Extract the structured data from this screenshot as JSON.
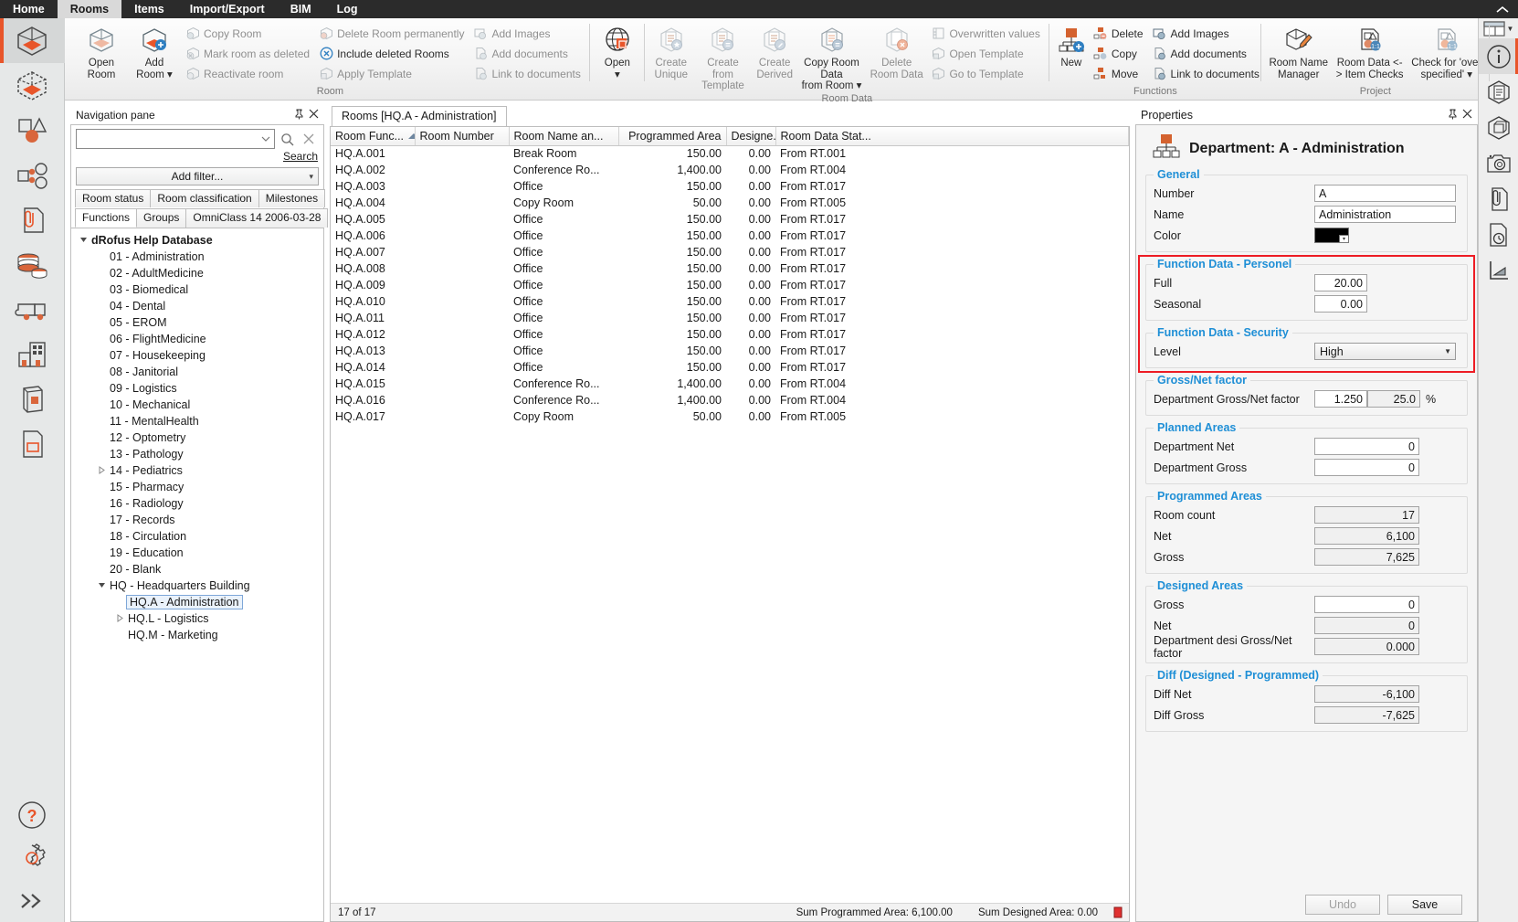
{
  "menubar": {
    "items": [
      {
        "label": "Home",
        "active": false
      },
      {
        "label": "Rooms",
        "active": true
      },
      {
        "label": "Items",
        "active": false
      },
      {
        "label": "Import/Export",
        "active": false
      },
      {
        "label": "BIM",
        "active": false
      },
      {
        "label": "Log",
        "active": false
      }
    ]
  },
  "ribbon": {
    "groups": [
      {
        "title": "Room",
        "big": [
          {
            "label": "Open\nRoom",
            "icon": "open-room-icon",
            "dim": false
          },
          {
            "label": "Add\nRoom ▾",
            "icon": "add-room-icon",
            "dim": false
          }
        ],
        "smallcols": [
          [
            {
              "label": "Copy Room",
              "icon": "copy-room-icon",
              "dim": true
            },
            {
              "label": "Mark room as deleted",
              "icon": "mark-deleted-icon",
              "dim": true
            },
            {
              "label": "Reactivate room",
              "icon": "reactivate-room-icon",
              "dim": true
            }
          ],
          [
            {
              "label": "Delete Room permanently",
              "icon": "delete-room-icon",
              "dim": true
            },
            {
              "label": "Include deleted Rooms",
              "icon": "include-deleted-icon",
              "dim": false
            },
            {
              "label": "Apply Template",
              "icon": "apply-template-icon",
              "dim": true
            }
          ],
          [
            {
              "label": "Add Images",
              "icon": "add-images-icon",
              "dim": true
            },
            {
              "label": "Add documents",
              "icon": "add-documents-icon",
              "dim": true
            },
            {
              "label": "Link to documents",
              "icon": "link-documents-icon",
              "dim": true
            }
          ]
        ]
      },
      {
        "title": "",
        "big": [
          {
            "label": "Open\n▾",
            "icon": "open-globe-icon",
            "dim": false
          }
        ],
        "smallcols": []
      },
      {
        "title": "Room Data",
        "big": [
          {
            "label": "Create\nUnique",
            "icon": "create-unique-icon",
            "dim": true
          },
          {
            "label": "Create from\nTemplate",
            "icon": "create-from-template-icon",
            "dim": true
          },
          {
            "label": "Create\nDerived",
            "icon": "create-derived-icon",
            "dim": true
          },
          {
            "label": "Copy Room Data\nfrom Room ▾",
            "icon": "copy-room-data-icon",
            "dim": false
          },
          {
            "label": "Delete\nRoom Data",
            "icon": "delete-room-data-icon",
            "dim": true
          }
        ],
        "smallcols": [
          [
            {
              "label": "Overwritten values",
              "icon": "overwritten-values-icon",
              "dim": true
            },
            {
              "label": "Open Template",
              "icon": "open-template-icon",
              "dim": true
            },
            {
              "label": "Go to Template",
              "icon": "go-to-template-icon",
              "dim": true
            }
          ]
        ]
      },
      {
        "title": "Functions",
        "big": [
          {
            "label": "New",
            "icon": "new-function-icon",
            "dim": false
          }
        ],
        "smallcols": [
          [
            {
              "label": "Delete",
              "icon": "delete-function-icon",
              "dim": false
            },
            {
              "label": "Copy",
              "icon": "copy-function-icon",
              "dim": false
            },
            {
              "label": "Move",
              "icon": "move-function-icon",
              "dim": false
            }
          ],
          [
            {
              "label": "Add Images",
              "icon": "add-images-icon",
              "dim": false
            },
            {
              "label": "Add documents",
              "icon": "add-documents-icon",
              "dim": false
            },
            {
              "label": "Link to documents",
              "icon": "link-documents-icon",
              "dim": false
            }
          ]
        ]
      },
      {
        "title": "Project",
        "big": [
          {
            "label": "Room Name\nManager",
            "icon": "room-name-manager-icon",
            "dim": false
          },
          {
            "label": "Room Data <-\n> Item Checks",
            "icon": "room-data-item-checks-icon",
            "dim": false
          },
          {
            "label": "Check for 'over\nspecified' ▾",
            "icon": "check-over-specified-icon",
            "dim": false
          }
        ],
        "smallcols": []
      }
    ]
  },
  "leftrail": {
    "items": [
      {
        "icon": "rooms-cube-icon",
        "name": "rail-rooms",
        "selected": true
      },
      {
        "icon": "rooms-dashed-cube-icon",
        "name": "rail-room-templates",
        "selected": false
      },
      {
        "icon": "items-shapes-icon",
        "name": "rail-items",
        "selected": false
      },
      {
        "icon": "item-groups-icon",
        "name": "rail-item-groups",
        "selected": false
      },
      {
        "icon": "documents-clip-icon",
        "name": "rail-documents",
        "selected": false
      },
      {
        "icon": "coins-icon",
        "name": "rail-cost",
        "selected": false
      },
      {
        "icon": "truck-icon",
        "name": "rail-logistics",
        "selected": false
      },
      {
        "icon": "building-icon",
        "name": "rail-building",
        "selected": false
      },
      {
        "icon": "catalogue-book-icon",
        "name": "rail-catalogue",
        "selected": false
      },
      {
        "icon": "report-page-icon",
        "name": "rail-reports",
        "selected": false
      }
    ],
    "bottom": [
      {
        "icon": "help-question-icon",
        "name": "rail-help"
      },
      {
        "icon": "settings-gear-icon",
        "name": "rail-settings"
      },
      {
        "icon": "expand-chevrons-icon",
        "name": "rail-expand"
      }
    ]
  },
  "navpane": {
    "title": "Navigation pane",
    "search": {
      "value": "",
      "placeholder": "",
      "link_label": "Search"
    },
    "filter_button": "Add filter...",
    "tabs_row1": [
      {
        "label": "Room status",
        "active": false
      },
      {
        "label": "Room classification",
        "active": false
      },
      {
        "label": "Milestones",
        "active": false
      }
    ],
    "tabs_row2": [
      {
        "label": "Functions",
        "active": true
      },
      {
        "label": "Groups",
        "active": false
      },
      {
        "label": "OmniClass 14 2006-03-28",
        "active": false
      }
    ],
    "tree": [
      {
        "label": "dRofus Help Database",
        "indent": 0,
        "expander": "expanded",
        "bold": true,
        "selected": false
      },
      {
        "label": "01 - Administration",
        "indent": 1,
        "expander": "none",
        "bold": false,
        "selected": false
      },
      {
        "label": "02 - AdultMedicine",
        "indent": 1,
        "expander": "none",
        "bold": false,
        "selected": false
      },
      {
        "label": "03 - Biomedical",
        "indent": 1,
        "expander": "none",
        "bold": false,
        "selected": false
      },
      {
        "label": "04 - Dental",
        "indent": 1,
        "expander": "none",
        "bold": false,
        "selected": false
      },
      {
        "label": "05 - EROM",
        "indent": 1,
        "expander": "none",
        "bold": false,
        "selected": false
      },
      {
        "label": "06 - FlightMedicine",
        "indent": 1,
        "expander": "none",
        "bold": false,
        "selected": false
      },
      {
        "label": "07 - Housekeeping",
        "indent": 1,
        "expander": "none",
        "bold": false,
        "selected": false
      },
      {
        "label": "08 - Janitorial",
        "indent": 1,
        "expander": "none",
        "bold": false,
        "selected": false
      },
      {
        "label": "09 - Logistics",
        "indent": 1,
        "expander": "none",
        "bold": false,
        "selected": false
      },
      {
        "label": "10 - Mechanical",
        "indent": 1,
        "expander": "none",
        "bold": false,
        "selected": false
      },
      {
        "label": "11 - MentalHealth",
        "indent": 1,
        "expander": "none",
        "bold": false,
        "selected": false
      },
      {
        "label": "12 - Optometry",
        "indent": 1,
        "expander": "none",
        "bold": false,
        "selected": false
      },
      {
        "label": "13 - Pathology",
        "indent": 1,
        "expander": "none",
        "bold": false,
        "selected": false
      },
      {
        "label": "14 - Pediatrics",
        "indent": 1,
        "expander": "collapsed",
        "bold": false,
        "selected": false
      },
      {
        "label": "15 - Pharmacy",
        "indent": 1,
        "expander": "none",
        "bold": false,
        "selected": false
      },
      {
        "label": "16 - Radiology",
        "indent": 1,
        "expander": "none",
        "bold": false,
        "selected": false
      },
      {
        "label": "17 - Records",
        "indent": 1,
        "expander": "none",
        "bold": false,
        "selected": false
      },
      {
        "label": "18 - Circulation",
        "indent": 1,
        "expander": "none",
        "bold": false,
        "selected": false
      },
      {
        "label": "19 - Education",
        "indent": 1,
        "expander": "none",
        "bold": false,
        "selected": false
      },
      {
        "label": "20 - Blank",
        "indent": 1,
        "expander": "none",
        "bold": false,
        "selected": false
      },
      {
        "label": "HQ - Headquarters Building",
        "indent": 1,
        "expander": "expanded",
        "bold": false,
        "selected": false
      },
      {
        "label": "HQ.A - Administration",
        "indent": 2,
        "expander": "none",
        "bold": false,
        "selected": true
      },
      {
        "label": "HQ.L - Logistics",
        "indent": 2,
        "expander": "collapsed",
        "bold": false,
        "selected": false
      },
      {
        "label": "HQ.M - Marketing",
        "indent": 2,
        "expander": "none",
        "bold": false,
        "selected": false
      }
    ]
  },
  "grid": {
    "tab_label": "Rooms [HQ.A - Administration]",
    "columns": [
      {
        "label": "Room Func...",
        "align": "left",
        "sorted": "asc"
      },
      {
        "label": "Room Number",
        "align": "left",
        "sorted": ""
      },
      {
        "label": "Room Name an...",
        "align": "left",
        "sorted": ""
      },
      {
        "label": "Programmed Area",
        "align": "right",
        "sorted": ""
      },
      {
        "label": "Designe...",
        "align": "right",
        "sorted": ""
      },
      {
        "label": "Room Data Stat...",
        "align": "left",
        "sorted": ""
      }
    ],
    "rows": [
      [
        "HQ.A.001",
        "",
        "Break Room",
        "150.00",
        "0.00",
        "From RT.001"
      ],
      [
        "HQ.A.002",
        "",
        "Conference Ro...",
        "1,400.00",
        "0.00",
        "From RT.004"
      ],
      [
        "HQ.A.003",
        "",
        "Office",
        "150.00",
        "0.00",
        "From RT.017"
      ],
      [
        "HQ.A.004",
        "",
        "Copy Room",
        "50.00",
        "0.00",
        "From RT.005"
      ],
      [
        "HQ.A.005",
        "",
        "Office",
        "150.00",
        "0.00",
        "From RT.017"
      ],
      [
        "HQ.A.006",
        "",
        "Office",
        "150.00",
        "0.00",
        "From RT.017"
      ],
      [
        "HQ.A.007",
        "",
        "Office",
        "150.00",
        "0.00",
        "From RT.017"
      ],
      [
        "HQ.A.008",
        "",
        "Office",
        "150.00",
        "0.00",
        "From RT.017"
      ],
      [
        "HQ.A.009",
        "",
        "Office",
        "150.00",
        "0.00",
        "From RT.017"
      ],
      [
        "HQ.A.010",
        "",
        "Office",
        "150.00",
        "0.00",
        "From RT.017"
      ],
      [
        "HQ.A.011",
        "",
        "Office",
        "150.00",
        "0.00",
        "From RT.017"
      ],
      [
        "HQ.A.012",
        "",
        "Office",
        "150.00",
        "0.00",
        "From RT.017"
      ],
      [
        "HQ.A.013",
        "",
        "Office",
        "150.00",
        "0.00",
        "From RT.017"
      ],
      [
        "HQ.A.014",
        "",
        "Office",
        "150.00",
        "0.00",
        "From RT.017"
      ],
      [
        "HQ.A.015",
        "",
        "Conference Ro...",
        "1,400.00",
        "0.00",
        "From RT.004"
      ],
      [
        "HQ.A.016",
        "",
        "Conference Ro...",
        "1,400.00",
        "0.00",
        "From RT.004"
      ],
      [
        "HQ.A.017",
        "",
        "Copy Room",
        "50.00",
        "0.00",
        "From RT.005"
      ]
    ],
    "status": {
      "count": "17 of 17",
      "sum_programmed": "Sum Programmed Area: 6,100.00",
      "sum_designed": "Sum Designed Area: 0.00"
    }
  },
  "properties": {
    "title": "Properties",
    "heading": "Department: A - Administration",
    "groups": {
      "general": {
        "legend": "General",
        "number_label": "Number",
        "number_value": "A",
        "name_label": "Name",
        "name_value": "Administration",
        "color_label": "Color",
        "color_value": "#000000"
      },
      "personel": {
        "legend": "Function Data - Personel",
        "full_label": "Full",
        "full_value": "20.00",
        "seasonal_label": "Seasonal",
        "seasonal_value": "0.00"
      },
      "security": {
        "legend": "Function Data - Security",
        "level_label": "Level",
        "level_value": "High"
      },
      "grossnet": {
        "legend": "Gross/Net factor",
        "factor_label": "Department Gross/Net factor",
        "factor_value": "1.250",
        "pct_value": "25.0",
        "pct_symbol": "%"
      },
      "planned": {
        "legend": "Planned Areas",
        "net_label": "Department Net",
        "net_value": "0",
        "gross_label": "Department Gross",
        "gross_value": "0"
      },
      "programmed": {
        "legend": "Programmed Areas",
        "count_label": "Room count",
        "count_value": "17",
        "net_label": "Net",
        "net_value": "6,100",
        "gross_label": "Gross",
        "gross_value": "7,625"
      },
      "designed": {
        "legend": "Designed Areas",
        "gross_label": "Gross",
        "gross_value": "0",
        "net_label": "Net",
        "net_value": "0",
        "factor_label": "Department desi Gross/Net factor",
        "factor_value": "0.000"
      },
      "diff": {
        "legend": "Diff (Designed - Programmed)",
        "net_label": "Diff Net",
        "net_value": "-6,100",
        "gross_label": "Diff Gross",
        "gross_value": "-7,625"
      }
    },
    "footer": {
      "undo_label": "Undo",
      "save_label": "Save"
    },
    "highlight_color": "#ed1c24"
  },
  "rightrail": {
    "items": [
      {
        "icon": "info-circle-icon",
        "name": "rightrail-info",
        "selected": true
      },
      {
        "icon": "document-hex-icon",
        "name": "rightrail-properties",
        "selected": false
      },
      {
        "icon": "cube-hex-icon",
        "name": "rightrail-geometry",
        "selected": false
      },
      {
        "icon": "camera-icon",
        "name": "rightrail-images",
        "selected": false
      },
      {
        "icon": "attachment-page-icon",
        "name": "rightrail-attachments",
        "selected": false
      },
      {
        "icon": "history-clock-icon",
        "name": "rightrail-history",
        "selected": false
      },
      {
        "icon": "measure-icon",
        "name": "rightrail-measure",
        "selected": false
      }
    ],
    "layout_icon": "layout-grid-icon"
  }
}
